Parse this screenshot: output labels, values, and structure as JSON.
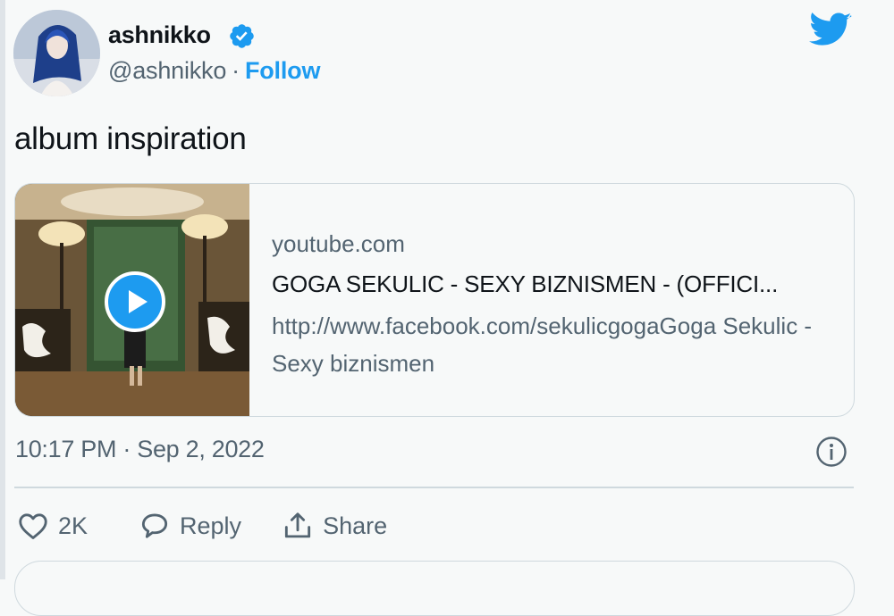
{
  "user": {
    "display_name": "ashnikko",
    "handle": "@ashnikko",
    "separator": "·",
    "follow_label": "Follow"
  },
  "tweet": {
    "text": "album inspiration",
    "timestamp": "10:17 PM · Sep 2, 2022"
  },
  "card": {
    "domain": "youtube.com",
    "title": "GOGA SEKULIC - SEXY BIZNISMEN - (OFFICI...",
    "description": "http://www.facebook.com/sekulicgogaGoga Sekulic - Sexy biznismen"
  },
  "actions": {
    "like_count": "2K",
    "reply_label": "Reply",
    "share_label": "Share"
  },
  "colors": {
    "accent": "#1d9bf0",
    "secondary_text": "#536471",
    "border": "#cfd9de"
  },
  "icons": [
    "verified-badge-icon",
    "twitter-bird-icon",
    "play-icon",
    "info-icon",
    "heart-icon",
    "reply-bubble-icon",
    "share-icon"
  ]
}
